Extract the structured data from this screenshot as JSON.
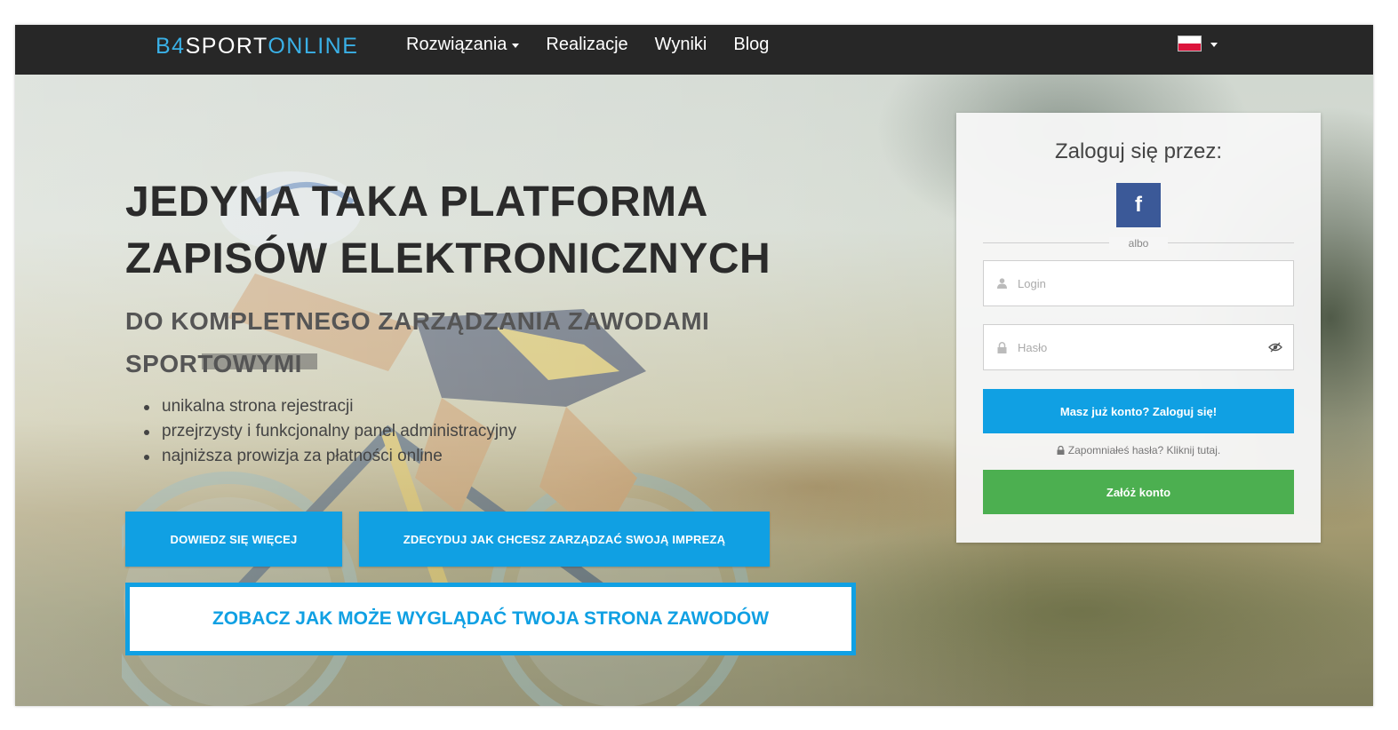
{
  "navbar": {
    "logo": {
      "part1": "B4",
      "part2": "SP",
      "part3": "O",
      "part4": "RT",
      "part5": "ONLINE"
    },
    "links": [
      {
        "label": "Rozwiązania",
        "dropdown": true
      },
      {
        "label": "Realizacje"
      },
      {
        "label": "Wyniki"
      },
      {
        "label": "Blog"
      }
    ],
    "language": {
      "icon": "poland-flag-icon"
    }
  },
  "hero": {
    "headline_line1": "JEDYNA TAKA PLATFORMA",
    "headline_line2": "ZAPISÓW ELEKTRONICZNYCH",
    "subheadline": "DO KOMPLETNEGO ZARZĄDZANIA ZAWODAMI SPORTOWYMI",
    "features": [
      "unikalna strona rejestracji",
      "przejrzysty i funkcjonalny panel administracyjny",
      "najniższa prowizja za płatności online"
    ],
    "button_more": "DOWIEDZ SIĘ WIĘCEJ",
    "button_manage": "ZDECYDUJ JAK CHCESZ ZARZĄDZAĆ SWOJĄ IMPREZĄ",
    "button_preview": "ZOBACZ JAK MOŻE WYGLĄDAĆ TWOJA STRONA ZAWODÓW"
  },
  "login": {
    "title": "Zaloguj się przez:",
    "facebook_label": "f",
    "separator": "albo",
    "login_placeholder": "Login",
    "password_placeholder": "Hasło",
    "login_button": "Masz już konto? Zaloguj się!",
    "forgot": "Zapomniałeś hasła? Kliknij tutaj.",
    "register_button": "Załóż konto"
  },
  "colors": {
    "accent": "#10a0e3",
    "success": "#4caf50",
    "navbar": "#272727",
    "facebook": "#3b5998"
  }
}
